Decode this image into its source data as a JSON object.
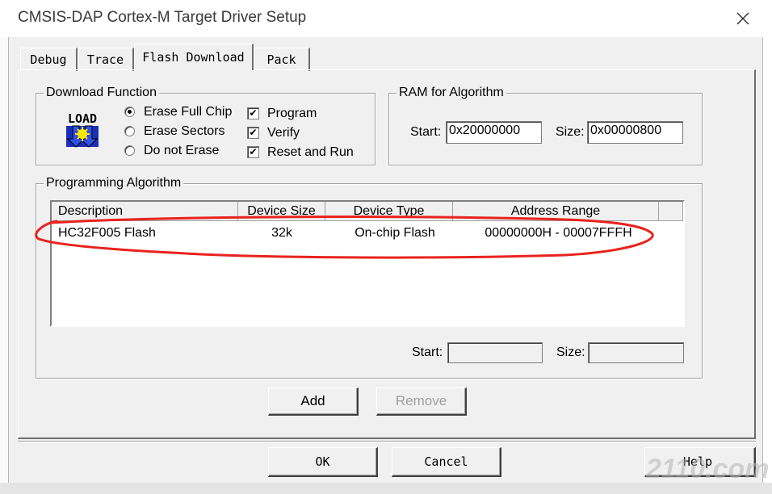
{
  "window": {
    "title": "CMSIS-DAP Cortex-M Target Driver Setup"
  },
  "tabs": [
    {
      "label": "Debug"
    },
    {
      "label": "Trace"
    },
    {
      "label": "Flash Download"
    },
    {
      "label": "Pack"
    }
  ],
  "download_function": {
    "group_label": "Download Function",
    "icon_text": "LOAD",
    "erase_options": [
      {
        "label": "Erase Full Chip",
        "selected": true
      },
      {
        "label": "Erase Sectors",
        "selected": false
      },
      {
        "label": "Do not Erase",
        "selected": false
      }
    ],
    "check_options": [
      {
        "label": "Program",
        "checked": true
      },
      {
        "label": "Verify",
        "checked": true
      },
      {
        "label": "Reset and Run",
        "checked": true
      }
    ]
  },
  "ram_for_algorithm": {
    "group_label": "RAM for Algorithm",
    "start_label": "Start:",
    "start_value": "0x20000000",
    "size_label": "Size:",
    "size_value": "0x00000800"
  },
  "programming_algorithm": {
    "group_label": "Programming Algorithm",
    "columns": [
      "Description",
      "Device Size",
      "Device Type",
      "Address Range"
    ],
    "rows": [
      {
        "description": "HC32F005 Flash",
        "device_size": "32k",
        "device_type": "On-chip Flash",
        "address_range": "00000000H - 00007FFFH"
      }
    ],
    "start_label": "Start:",
    "start_value": "",
    "size_label": "Size:",
    "size_value": ""
  },
  "buttons": {
    "add": "Add",
    "remove": "Remove",
    "ok": "OK",
    "cancel": "Cancel",
    "help": "Help"
  },
  "watermark": "2110.com",
  "annotation": {
    "color": "#e8231e"
  }
}
